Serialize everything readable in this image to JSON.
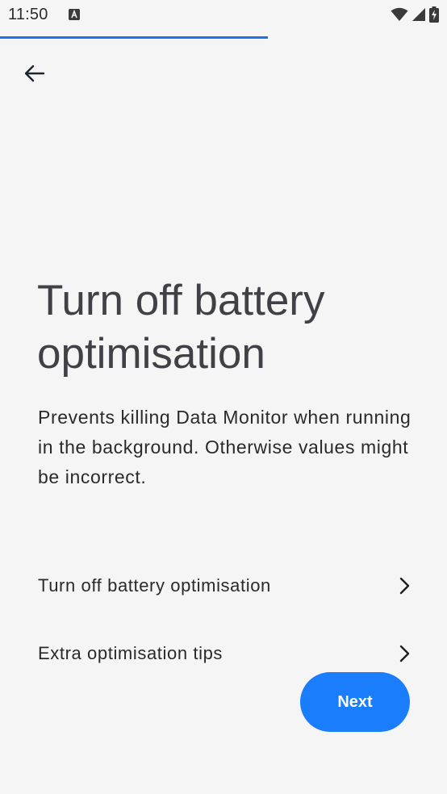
{
  "status_bar": {
    "time": "11:50",
    "notification_icon": "a-notification-icon",
    "wifi_icon": "wifi-icon",
    "signal_icon": "signal-icon",
    "battery_icon": "battery-charging-icon"
  },
  "progress": {
    "fraction": 0.6
  },
  "nav": {
    "back_icon": "arrow-back-icon"
  },
  "page": {
    "title": "Turn off battery optimisation",
    "description": "Prevents killing Data Monitor when running in the background. Otherwise values might be incorrect."
  },
  "options": [
    {
      "label": "Turn off battery optimisation",
      "icon": "chevron-right-icon"
    },
    {
      "label": "Extra optimisation tips",
      "icon": "chevron-right-icon"
    }
  ],
  "actions": {
    "next_label": "Next"
  },
  "colors": {
    "background": "#f5f5f5",
    "accent": "#1a7dfc",
    "progress": "#1a73e8",
    "title": "#414046"
  }
}
